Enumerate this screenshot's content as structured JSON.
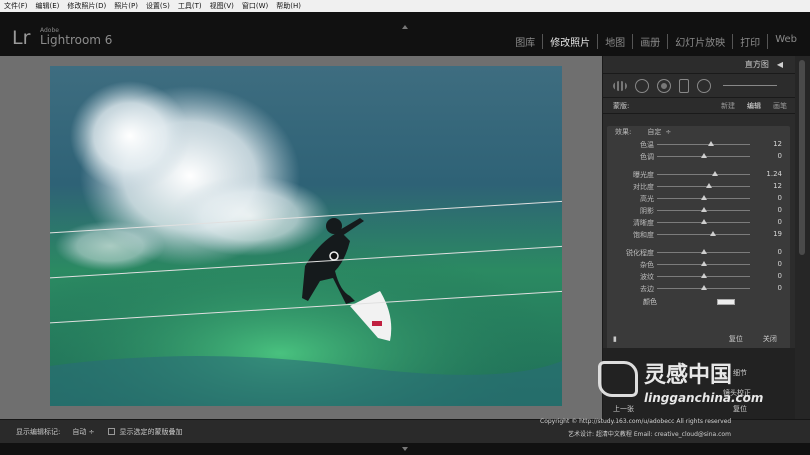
{
  "menu": [
    "文件(F)",
    "编辑(E)",
    "修改照片(D)",
    "照片(P)",
    "设置(S)",
    "工具(T)",
    "视图(V)",
    "窗口(W)",
    "帮助(H)"
  ],
  "app": {
    "logo": "Lr",
    "brand": "Adobe",
    "product": "Lightroom 6"
  },
  "modules": [
    {
      "label": "图库",
      "active": false
    },
    {
      "label": "修改照片",
      "active": true
    },
    {
      "label": "地图",
      "active": false
    },
    {
      "label": "画册",
      "active": false
    },
    {
      "label": "幻灯片放映",
      "active": false
    },
    {
      "label": "打印",
      "active": false
    },
    {
      "label": "Web",
      "active": false
    }
  ],
  "panel": {
    "histogram_label": "直方图",
    "mask": {
      "label": "蒙版:",
      "new": "新建",
      "edit": "编辑",
      "brush": "画笔"
    },
    "effect": {
      "label": "效果:",
      "value": "自定"
    },
    "sliders_temp": [
      {
        "label": "色温",
        "value": "12",
        "pos": 0.58
      },
      {
        "label": "色调",
        "value": "0",
        "pos": 0.5
      }
    ],
    "sliders_tone": [
      {
        "label": "曝光度",
        "value": "1.24",
        "pos": 0.62
      },
      {
        "label": "对比度",
        "value": "12",
        "pos": 0.56
      },
      {
        "label": "高光",
        "value": "0",
        "pos": 0.5
      },
      {
        "label": "阴影",
        "value": "0",
        "pos": 0.5
      },
      {
        "label": "清晰度",
        "value": "0",
        "pos": 0.5
      },
      {
        "label": "饱和度",
        "value": "19",
        "pos": 0.6
      }
    ],
    "sliders_detail": [
      {
        "label": "锐化程度",
        "value": "0",
        "pos": 0.5
      },
      {
        "label": "杂色",
        "value": "0",
        "pos": 0.5
      },
      {
        "label": "波纹",
        "value": "0",
        "pos": 0.5
      },
      {
        "label": "去边",
        "value": "0",
        "pos": 0.5
      }
    ],
    "color_label": "颜色",
    "reset": "复位",
    "close": "关闭",
    "lower": {
      "detail": "细节",
      "lens": "镜头校正",
      "prev": "上一张",
      "reset_all": "复位"
    }
  },
  "toolbar": {
    "show_overlay": "显示编辑标记:",
    "overlay_value": "自动 ÷",
    "show_mask": "显示选定的蒙版叠加"
  },
  "watermark": {
    "big": "灵感中国",
    "url": "lingganchina.com"
  },
  "copyright": {
    "line1": "Copyright © http://study.163.com/u/adobecc All rights reserved",
    "line2": "艺术设计: 超清中文教程 Email: creative_cloud@sina.com"
  },
  "colors": {
    "accent_active": "#e6e6e6",
    "panel": "#2c2c2c",
    "section": "#3a3a3a"
  }
}
